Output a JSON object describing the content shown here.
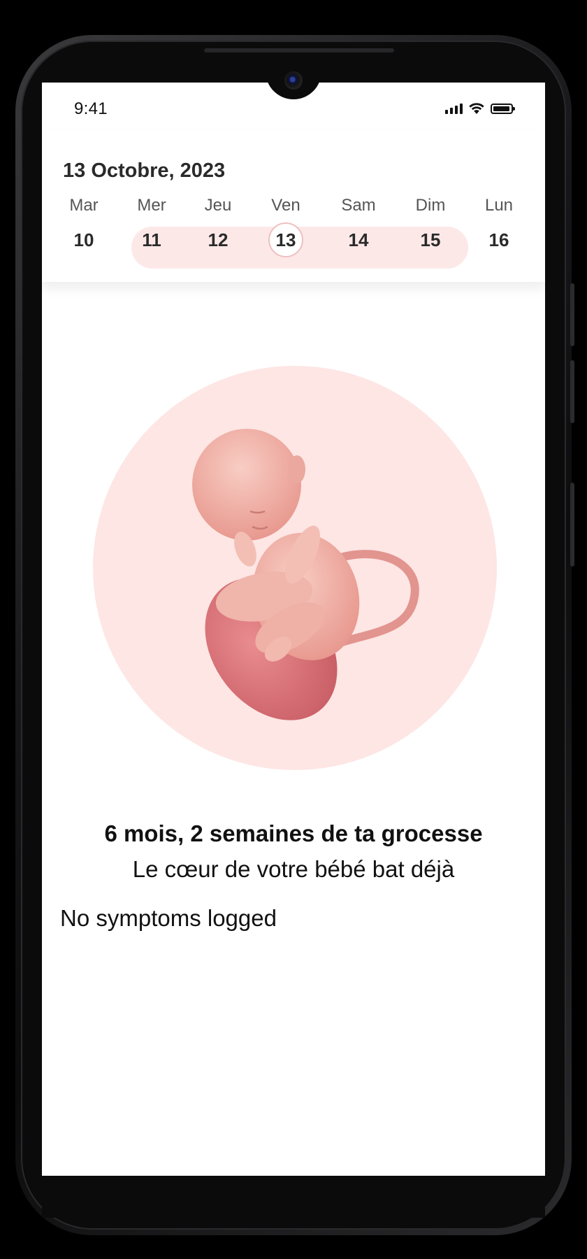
{
  "status_bar": {
    "time": "9:41",
    "icons": [
      "cellular-signal-icon",
      "wifi-icon",
      "battery-icon"
    ]
  },
  "header": {
    "date_title": "13 Octobre, 2023"
  },
  "week": {
    "days": [
      {
        "name": "Mar",
        "num": "10",
        "in_range": false,
        "selected": false
      },
      {
        "name": "Mer",
        "num": "11",
        "in_range": true,
        "selected": false
      },
      {
        "name": "Jeu",
        "num": "12",
        "in_range": true,
        "selected": false
      },
      {
        "name": "Ven",
        "num": "13",
        "in_range": true,
        "selected": true
      },
      {
        "name": "Sam",
        "num": "14",
        "in_range": true,
        "selected": false
      },
      {
        "name": "Dim",
        "num": "15",
        "in_range": true,
        "selected": false
      },
      {
        "name": "Lun",
        "num": "16",
        "in_range": false,
        "selected": false
      }
    ]
  },
  "main": {
    "illustration": "fetus-illustration",
    "headline": "6 mois, 2 semaines de ta grocesse",
    "subline": "Le cœur de votre bébé bat déjà",
    "symptoms": "No symptoms logged"
  },
  "colors": {
    "accent_pink": "#fde8e8",
    "selected_ring": "#eec0bf",
    "illustration_bg": "#fde6e4",
    "text_dark": "#111111"
  }
}
